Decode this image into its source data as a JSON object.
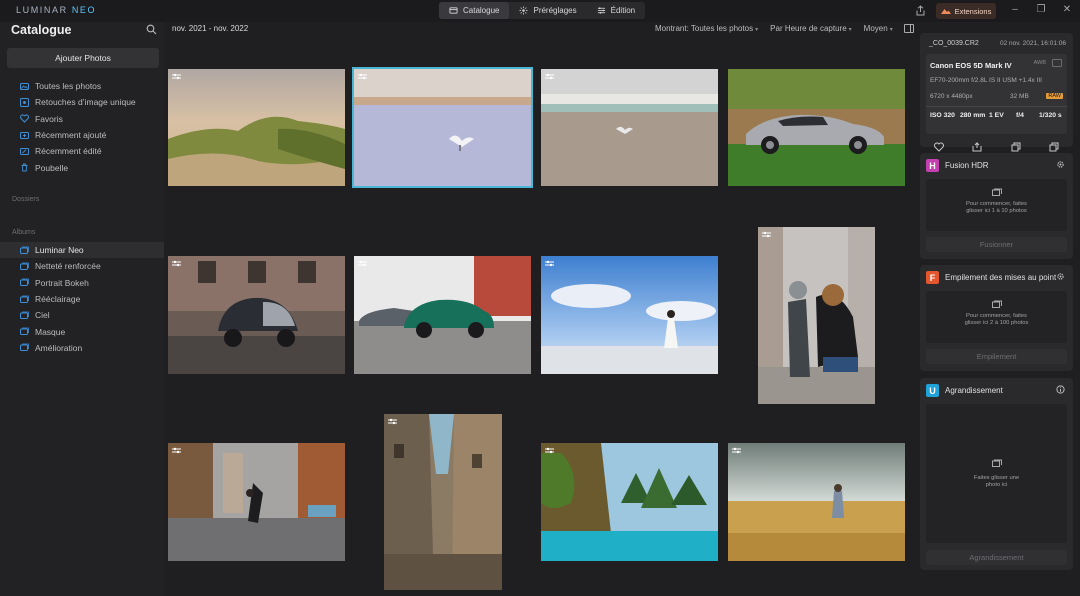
{
  "app": {
    "logo_prefix": "LUMINAR",
    "logo_suffix": "NEO",
    "modes": [
      {
        "label": "Catalogue",
        "icon": "catalog-icon",
        "active": true
      },
      {
        "label": "Préréglages",
        "icon": "presets-icon",
        "active": false
      },
      {
        "label": "Édition",
        "icon": "edit-sliders-icon",
        "active": false
      }
    ],
    "extensions_label": "Extensions",
    "accent": "#49b6d6"
  },
  "sidebar": {
    "title": "Catalogue",
    "add_button": "Ajouter Photos",
    "items": [
      {
        "label": "Toutes les photos",
        "icon": "photos-icon"
      },
      {
        "label": "Retouches d’image unique",
        "icon": "single-edit-icon"
      },
      {
        "label": "Favoris",
        "icon": "heart-icon"
      },
      {
        "label": "Récemment ajouté",
        "icon": "recent-added-icon"
      },
      {
        "label": "Récemment édité",
        "icon": "recent-edited-icon"
      },
      {
        "label": "Poubelle",
        "icon": "trash-icon"
      }
    ],
    "folders_label": "Dossiers",
    "albums_label": "Albums",
    "albums": [
      {
        "label": "Luminar Neo",
        "active": true
      },
      {
        "label": "Netteté renforcée",
        "active": false
      },
      {
        "label": "Portrait Bokeh",
        "active": false
      },
      {
        "label": "Rééclairage",
        "active": false
      },
      {
        "label": "Ciel",
        "active": false
      },
      {
        "label": "Masque",
        "active": false
      },
      {
        "label": "Amélioration",
        "active": false
      }
    ]
  },
  "gallery": {
    "date_range": "nov. 2021 - nov. 2022",
    "showing": "Montrant: Toutes les photos",
    "sort": "Par Heure de capture",
    "size": "Moyen",
    "photos": [
      {
        "subject": "grassy dunes",
        "selected": false
      },
      {
        "subject": "seagull on beach",
        "selected": true
      },
      {
        "subject": "seagull on sand",
        "selected": false
      },
      {
        "subject": "silver sports car",
        "selected": false
      },
      {
        "subject": "black smart car",
        "selected": false
      },
      {
        "subject": "green car",
        "selected": false
      },
      {
        "subject": "woman on beach",
        "selected": false
      },
      {
        "subject": "mother and child",
        "selected": false
      },
      {
        "subject": "street dancer",
        "selected": false
      },
      {
        "subject": "narrow alley",
        "selected": false
      },
      {
        "subject": "turquoise lake",
        "selected": false
      },
      {
        "subject": "wheat field",
        "selected": false
      }
    ]
  },
  "info": {
    "filename": "_CO_0039.CR2",
    "datetime": "02 nov. 2021, 16:01:06",
    "camera": "Canon EOS 5D Mark IV",
    "awb": "AWB",
    "lens": "EF70-200mm f/2.8L IS II USM +1.4x III",
    "resolution": "6720 x 4480px",
    "size": "32 MB",
    "format": "RAW",
    "iso": "ISO 320",
    "focal": "280 mm",
    "ev": "1 EV",
    "aperture": "f/4",
    "shutter": "1/320 s"
  },
  "tools": [
    {
      "title": "Fusion HDR",
      "logo": "H",
      "color": "#c43fb0",
      "drop_text": "Pour commencer, faites glisser ici 1 à 10 photos",
      "button": "Fusionner",
      "side_icon": "gear-icon"
    },
    {
      "title": "Empilement des mises au point",
      "logo": "F",
      "color": "#e4572e",
      "drop_text": "Pour commencer, faites glisser ici 2 à 100 photos",
      "button": "Empilement",
      "side_icon": "gear-icon"
    },
    {
      "title": "Agrandissement",
      "logo": "U",
      "color": "#1fa3d8",
      "drop_text": "Faites glisser une photo ici",
      "button": "Agrandissement",
      "side_icon": "info-icon"
    }
  ]
}
